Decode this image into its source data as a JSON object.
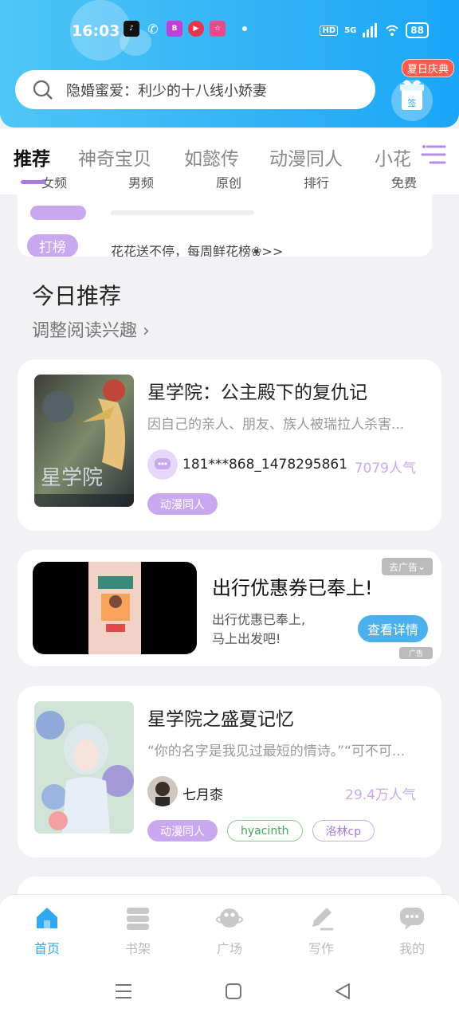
{
  "status_bar": {
    "time": "16:03",
    "network": "5G",
    "hd": "HD",
    "battery": "88"
  },
  "search": {
    "placeholder": "隐婚蜜爱：利少的十八线小娇妻"
  },
  "gift": {
    "badge": "夏日庆典",
    "label": "签"
  },
  "tabs": [
    {
      "label": "推荐",
      "active": true
    },
    {
      "label": "神奇宝贝"
    },
    {
      "label": "如懿传"
    },
    {
      "label": "动漫同人"
    },
    {
      "label": "小花"
    }
  ],
  "subtabs": [
    "女频",
    "男频",
    "原创",
    "排行",
    "免费"
  ],
  "notice": {
    "tag": "打榜",
    "text": "花花送不停，每周鲜花榜❀>>"
  },
  "section": {
    "title": "今日推荐",
    "subtitle": "调整阅读兴趣"
  },
  "books": [
    {
      "title": "星学院：公主殿下的复仇记",
      "desc": "因自己的亲人、朋友、族人被瑞拉人杀害...",
      "author": "181***868_1478295861",
      "popularity": "7079人气",
      "tags": [
        "动漫同人"
      ]
    },
    {
      "title": "星学院之盛夏记忆",
      "desc": "“你的名字是我见过最短的情诗。”“可不可...",
      "author": "七月桼",
      "popularity": "29.4万人气",
      "tags": [
        "动漫同人",
        "hyacinth",
        "洛林cp"
      ]
    }
  ],
  "ad": {
    "title": "出行优惠券已奉上!",
    "desc_line1": "出行优惠已奉上,",
    "desc_line2": "马上出发吧!",
    "button": "查看详情",
    "tag": "去广告",
    "mark": "广告"
  },
  "bottom_nav": [
    {
      "label": "首页",
      "icon": "home-icon",
      "active": true
    },
    {
      "label": "书架",
      "icon": "bookshelf-icon"
    },
    {
      "label": "广场",
      "icon": "planet-icon"
    },
    {
      "label": "写作",
      "icon": "pen-icon"
    },
    {
      "label": "我的",
      "icon": "chat-bubble-icon"
    }
  ],
  "colors": {
    "accent": "#2fa9f2",
    "tag_purple": "#c9a8f0",
    "header_start": "#4fc6f6",
    "header_end": "#1aa6f6"
  }
}
